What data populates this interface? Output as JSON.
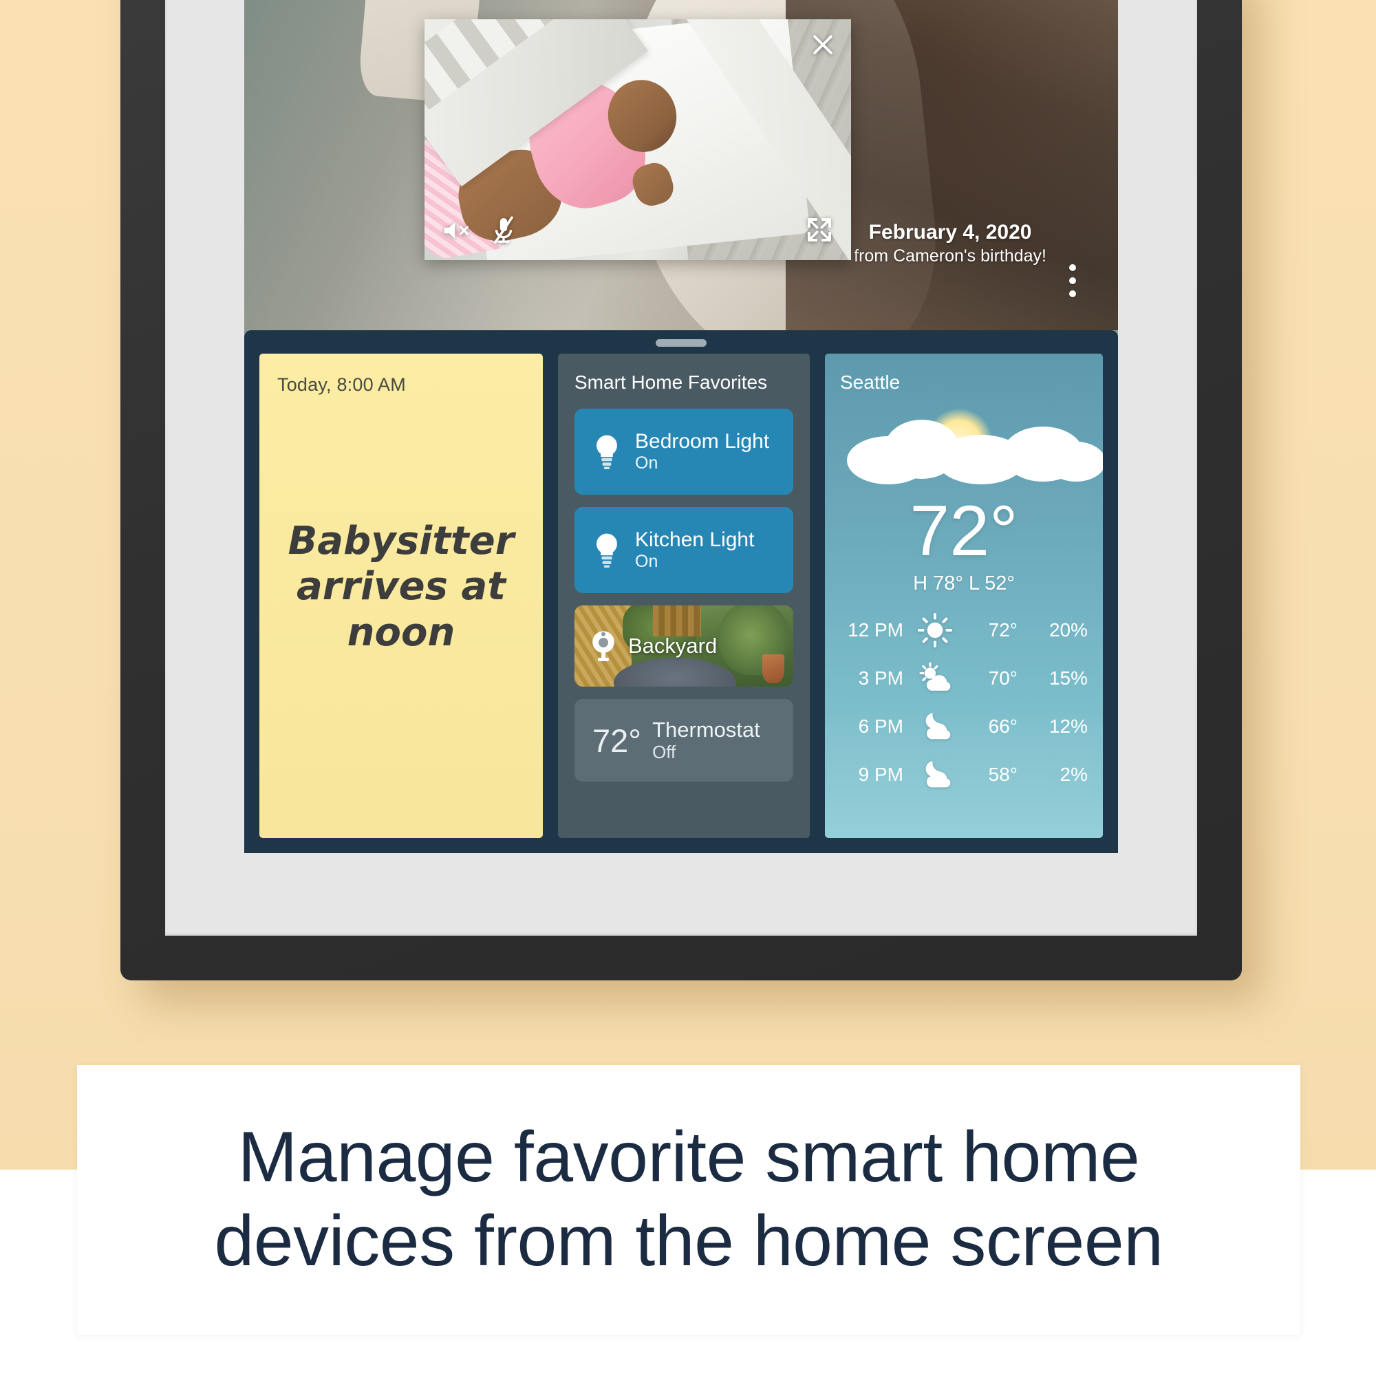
{
  "background": {
    "tan_color": "#f8dfb2",
    "white_color": "#ffffff"
  },
  "device": {
    "frame_color": "#303030",
    "bezel_color": "#e6e6e6"
  },
  "photo": {
    "date": "February 4, 2020",
    "subtitle": "from Cameron's birthday!",
    "more_icon": "more-vertical-icon"
  },
  "pip_video": {
    "close_icon": "close-icon",
    "mute_icon": "speaker-mute-icon",
    "mic_off_icon": "microphone-off-icon",
    "expand_icon": "fullscreen-expand-icon"
  },
  "tray": {
    "handle": "drag-handle"
  },
  "note": {
    "time": "Today, 8:00 AM",
    "body": "Babysitter arrives at noon"
  },
  "smart_home": {
    "title": "Smart Home Favorites",
    "accent_color": "#2787b4",
    "devices": [
      {
        "name": "Bedroom Light",
        "state": "On",
        "icon": "lightbulb-icon"
      },
      {
        "name": "Kitchen Light",
        "state": "On",
        "icon": "lightbulb-icon"
      }
    ],
    "camera": {
      "name": "Backyard",
      "icon": "camera-icon"
    },
    "thermostat": {
      "temp": "72°",
      "name": "Thermostat",
      "state": "Off"
    }
  },
  "weather": {
    "city": "Seattle",
    "temp": "72°",
    "hilo": "H 78°  L 52°",
    "condition_icon": "partly-cloudy-sun-icon",
    "forecast": [
      {
        "time": "12 PM",
        "icon": "sun-icon",
        "temp": "72°",
        "pop": "20%"
      },
      {
        "time": "3 PM",
        "icon": "partly-cloudy-icon",
        "temp": "70°",
        "pop": "15%"
      },
      {
        "time": "6 PM",
        "icon": "night-cloud-icon",
        "temp": "66°",
        "pop": "12%"
      },
      {
        "time": "9 PM",
        "icon": "night-cloud-icon",
        "temp": "58°",
        "pop": "2%"
      }
    ]
  },
  "caption": {
    "text": "Manage favorite smart home devices from the home screen",
    "color": "#1b2b42"
  }
}
